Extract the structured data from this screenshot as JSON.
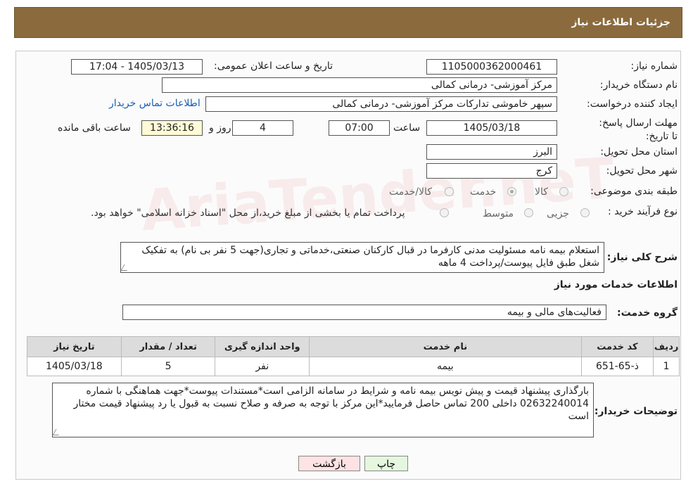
{
  "header": {
    "title": "جزئیات اطلاعات نیاز"
  },
  "form": {
    "need_number": {
      "label": "شماره نیاز:",
      "value": "1105000362000461"
    },
    "announce_datetime": {
      "label": "تاریخ و ساعت اعلان عمومی:",
      "value": "1405/03/13 - 17:04"
    },
    "buyer_org": {
      "label": "نام دستگاه خریدار:",
      "value": "مرکز آموزشی- درمانی کمالی"
    },
    "requester": {
      "label": "ایجاد کننده درخواست:",
      "value": "سپهر خاموشی تدارکات مرکز آموزشی- درمانی کمالی",
      "contact_link": "اطلاعات تماس خریدار"
    },
    "deadline": {
      "label": "مهلت ارسال پاسخ: تا تاریخ:",
      "date": "1405/03/18",
      "time_label": "ساعت",
      "time": "07:00",
      "days": "4",
      "days_label": "روز و",
      "remaining": "13:36:16",
      "remaining_label": "ساعت باقی مانده"
    },
    "province": {
      "label": "استان محل تحویل:",
      "value": "البرز"
    },
    "city": {
      "label": "شهر محل تحویل:",
      "value": "کرج"
    },
    "category": {
      "label": "طبقه بندی موضوعی:",
      "options": [
        "کالا",
        "خدمت",
        "کالا/خدمت"
      ],
      "selected": "خدمت"
    },
    "purchase_type": {
      "label": "نوع فرآیند خرید :",
      "options": [
        "جزیی",
        "متوسط"
      ],
      "note": "پرداخت تمام یا بخشی از مبلغ خرید،از محل \"اسناد خزانه اسلامی\" خواهد بود."
    },
    "summary": {
      "label": "شرح کلی نیاز:",
      "value": "استعلام بیمه نامه مسئولیت مدنی کارفرما در قبال کارکنان صنعتی،خدماتی و تجاری(جهت 5 نفر بی نام) به تفکیک شغل طبق فایل پیوست/پرداخت 4 ماهه"
    }
  },
  "services": {
    "title": "اطلاعات خدمات مورد نیاز",
    "group_label": "گروه خدمت:",
    "group_value": "فعالیت‌های مالی و بیمه",
    "columns": [
      "ردیف",
      "کد خدمت",
      "نام خدمت",
      "واحد اندازه گیری",
      "تعداد / مقدار",
      "تاریخ نیاز"
    ],
    "rows": [
      [
        "1",
        "ذ-65-651",
        "بیمه",
        "نفر",
        "5",
        "1405/03/18"
      ]
    ]
  },
  "buyer_notes": {
    "label": "توضیحات خریدار:",
    "value": "بارگذاری پیشنهاد قیمت و پیش نویس بیمه نامه و شرایط در سامانه الزامی است*مستندات پیوست*جهت هماهنگی با شماره 02632240014 داخلی 200 تماس حاصل فرمایید*این مرکز با توجه به صرفه و صلاح نسبت به قبول یا رد پیشنهاد قیمت مختار است"
  },
  "buttons": {
    "print": "چاپ",
    "back": "بازگشت"
  },
  "watermark": "AriaTender.neT",
  "colors": {
    "header_bg": "#8b6b3d",
    "link": "#1a5fb4",
    "back_btn_bg": "#fde3e3",
    "print_btn_bg": "#e6f7e0"
  }
}
